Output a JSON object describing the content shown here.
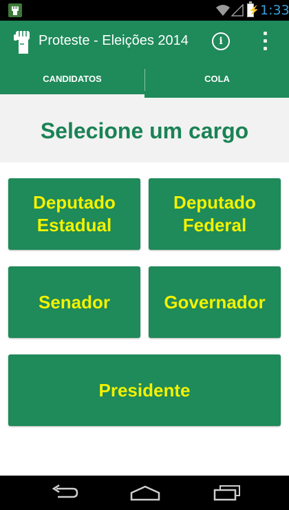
{
  "status_bar": {
    "time": "1:33",
    "icons": [
      "notification-fist-icon",
      "wifi-icon",
      "signal-icon",
      "battery-charging-icon"
    ]
  },
  "app_bar": {
    "title": "Proteste - Eleições 2014",
    "logo_icon": "raised-fist-icon",
    "info_icon": "info-icon",
    "info_glyph": "i",
    "overflow_icon": "overflow-menu-icon"
  },
  "tabs": [
    {
      "label": "CANDIDATOS",
      "active": true
    },
    {
      "label": "COLA",
      "active": false
    }
  ],
  "main": {
    "heading": "Selecione um cargo",
    "buttons": [
      {
        "line1": "Deputado",
        "line2": "Estadual"
      },
      {
        "line1": "Deputado",
        "line2": "Federal"
      },
      {
        "line1": "Senador"
      },
      {
        "line1": "Governador"
      },
      {
        "line1": "Presidente"
      }
    ]
  },
  "nav_bar": {
    "icons": [
      "back-icon",
      "home-icon",
      "recent-apps-icon"
    ]
  },
  "colors": {
    "primary": "#1f8a5a",
    "heading_text": "#1a8255",
    "button_text": "#f2f200",
    "header_bg": "#f2f2f2",
    "clock": "#3aa0d8"
  }
}
